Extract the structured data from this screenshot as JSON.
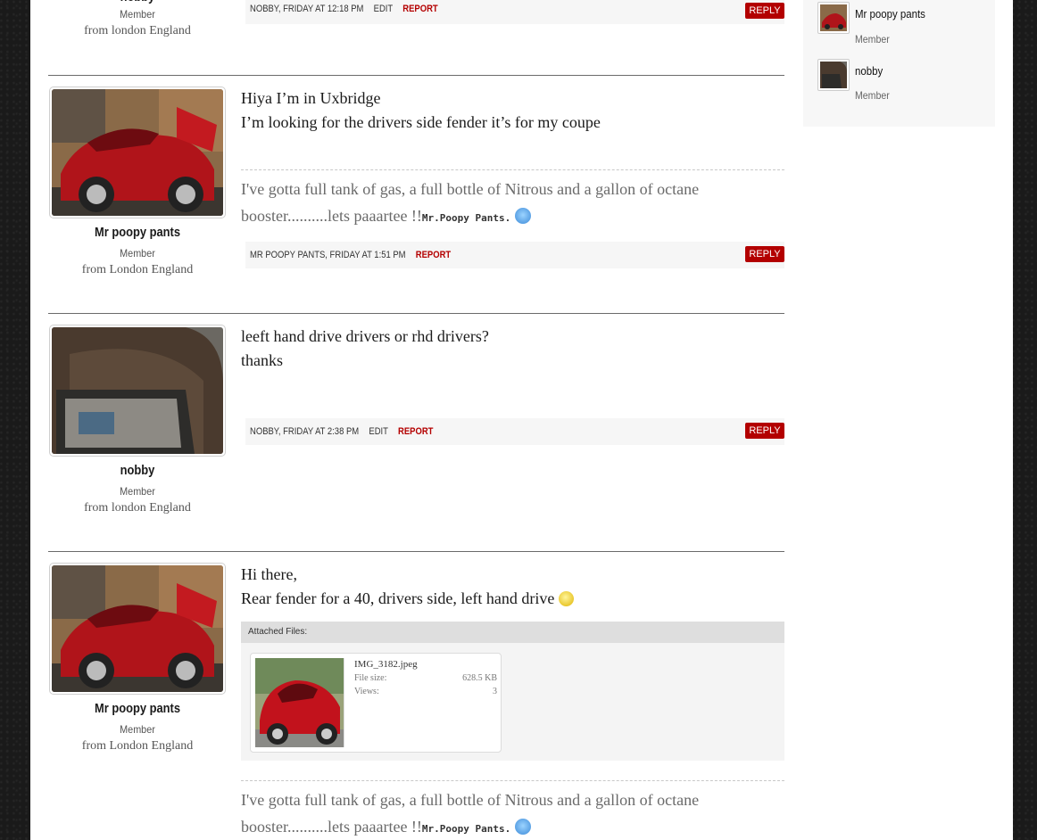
{
  "posts": [
    {
      "username": "nobby",
      "usertitle": "Member",
      "location": "from london England",
      "meta_author": "nobby, Friday at 12:18 PM",
      "edit_label": "Edit",
      "report_label": "Report",
      "reply_label": "REPLY"
    },
    {
      "username": "Mr poopy pants",
      "usertitle": "Member",
      "location": "from London England",
      "body": [
        "Hiya I’m in Uxbridge",
        "I’m looking for the drivers side fender it’s for my coupe"
      ],
      "signature": "I've gotta full tank of gas, a full bottle of Nitrous and a gallon of octane booster..........lets paaartee !!",
      "signature_name": "Mr.Poopy Pants.",
      "meta_author": "Mr poopy pants, Friday at 1:51 PM",
      "report_label": "Report",
      "reply_label": "REPLY"
    },
    {
      "username": "nobby",
      "usertitle": "Member",
      "location": "from london England",
      "body": [
        "leeft hand drive drivers or rhd drivers?",
        "thanks"
      ],
      "meta_author": "nobby, Friday at 2:38 PM",
      "edit_label": "Edit",
      "report_label": "Report",
      "reply_label": "REPLY"
    },
    {
      "username": "Mr poopy pants",
      "usertitle": "Member",
      "location": "from London England",
      "body": [
        "Hi there,",
        "Rear fender for a 40, drivers side, left hand drive"
      ],
      "attachments_header": "Attached Files:",
      "attachment": {
        "filename": "IMG_3182.jpeg",
        "size_label": "File size:",
        "size_value": "628.5 KB",
        "views_label": "Views:",
        "views_value": "3"
      },
      "signature": "I've gotta full tank of gas, a full bottle of Nitrous and a gallon of octane booster..........lets paaartee !!",
      "signature_name": "Mr.Poopy Pants."
    }
  ],
  "sidebar": {
    "members": [
      {
        "name": "Mr poopy pants",
        "title": "Member"
      },
      {
        "name": "nobby",
        "title": "Member"
      }
    ]
  },
  "colors": {
    "reply_button": "#b30000",
    "report_link": "#b40000"
  }
}
